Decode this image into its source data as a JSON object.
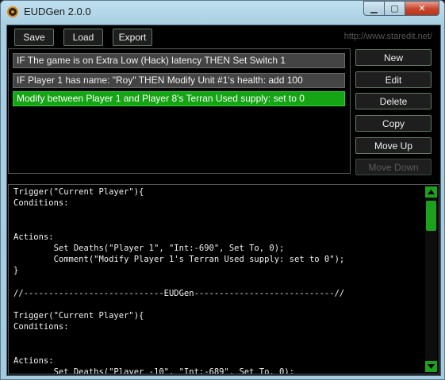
{
  "window": {
    "title": "EUDGen 2.0.0",
    "controls": {
      "minimize": "▁",
      "maximize": "▢",
      "close": "✕"
    }
  },
  "toolbar": {
    "save_label": "Save",
    "load_label": "Load",
    "export_label": "Export",
    "url": "http://www.staredit.net/"
  },
  "actions_list": [
    {
      "text": "IF The game is on Extra Low (Hack) latency THEN Set Switch 1",
      "selected": false
    },
    {
      "text": "IF Player 1 has name: \"Roy\" THEN Modify Unit #1's health: add 100",
      "selected": false
    },
    {
      "text": "Modify between Player 1 and Player 8's Terran Used supply: set to 0",
      "selected": true
    }
  ],
  "side_buttons": {
    "new": "New",
    "edit": "Edit",
    "delete": "Delete",
    "copy": "Copy",
    "move_up": "Move Up",
    "move_down": "Move Down"
  },
  "code_lines": [
    "Trigger(\"Current Player\"){",
    "Conditions:",
    "",
    "",
    "Actions:",
    "        Set Deaths(\"Player 1\", \"Int:-690\", Set To, 0);",
    "        Comment(\"Modify Player 1's Terran Used supply: set to 0\");",
    "}",
    "",
    "//----------------------------EUDGen----------------------------//",
    "",
    "Trigger(\"Current Player\"){",
    "Conditions:",
    "",
    "",
    "Actions:",
    "        Set Deaths(\"Player -10\", \"Int:-689\", Set To, 0);"
  ],
  "colors": {
    "selected_item": "#14a414",
    "accent_green": "#1da01d",
    "close_button": "#c8452c"
  }
}
